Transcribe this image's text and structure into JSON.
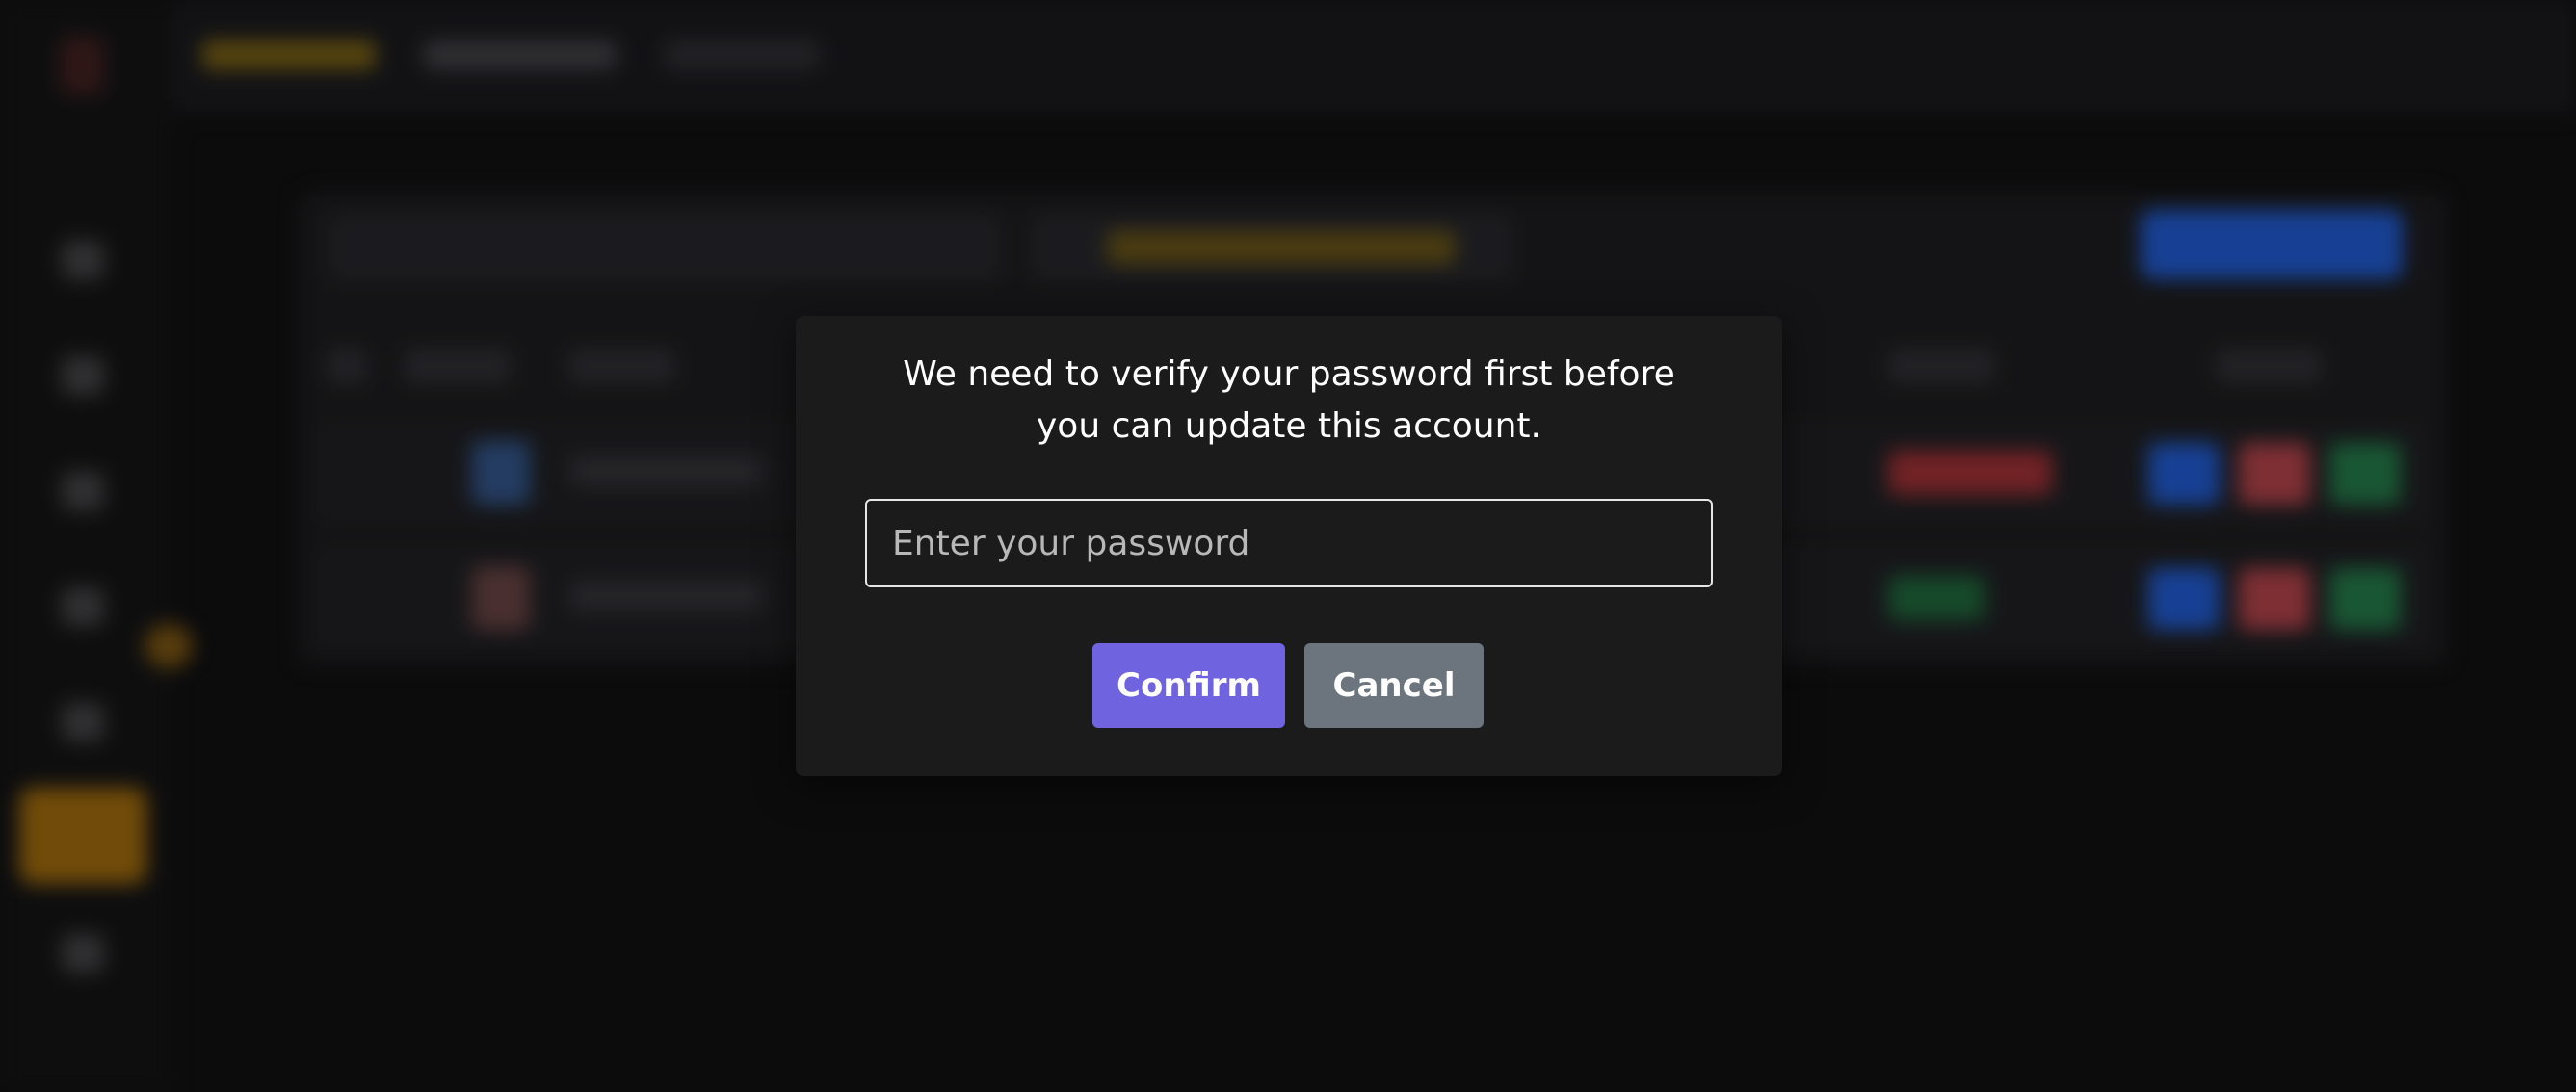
{
  "colors": {
    "confirm_button": "#6f63df",
    "cancel_button": "#6c757d",
    "modal_background": "#1b1b1c",
    "page_background": "#0f0f10",
    "accent_active_nav": "#8a5c0c",
    "create_button": "#1d4fb5",
    "status_red": "#8a2a2e",
    "status_green": "#1c5a34",
    "action_blue": "#1d4fb5",
    "action_red": "#9a3a40",
    "action_green": "#1f6a40"
  },
  "sidebar": {
    "icons": [
      "logo-icon",
      "dashboard-icon",
      "list-icon",
      "chart-icon",
      "folder-icon",
      "settings-icon",
      "users-icon",
      "logout-icon"
    ]
  },
  "modal": {
    "message": "We need to verify your password first before you can update this account.",
    "password_placeholder": "Enter your password",
    "password_value": "",
    "confirm_label": "Confirm",
    "cancel_label": "Cancel"
  }
}
